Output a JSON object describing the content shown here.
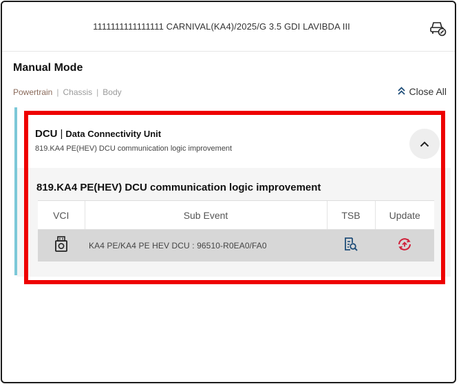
{
  "header": {
    "vehicle_info": "1111111111111111 CARNIVAL(KA4)/2025/G 3.5 GDI LAVIBDA III",
    "vehicle_icon": "car-check-icon"
  },
  "page": {
    "title": "Manual Mode"
  },
  "categories": {
    "tabs": [
      "Powertrain",
      "Chassis",
      "Body"
    ],
    "separator": "|",
    "active": "Powertrain"
  },
  "close_all": {
    "label": "Close All",
    "icon": "double-chevron-up-icon"
  },
  "module": {
    "code": "DCU",
    "separator": "|",
    "name": "Data Connectivity Unit",
    "summary": "819.KA4 PE(HEV) DCU communication logic improvement",
    "collapse_icon": "chevron-up-icon"
  },
  "event": {
    "title": "819.KA4 PE(HEV) DCU communication logic improvement",
    "columns": [
      "VCI",
      "Sub Event",
      "TSB",
      "Update"
    ],
    "rows": [
      {
        "vci_icon": "vci-device-icon",
        "sub_event": "KA4 PE/KA4 PE HEV DCU : 96510-R0EA0/FA0",
        "tsb_icon": "document-search-icon",
        "update_icon": "update-arrow-icon"
      }
    ]
  },
  "colors": {
    "accent_bar": "#7cc8d8",
    "highlight": "#ee0000",
    "update_icon": "#d0203a",
    "tsb_icon": "#1f4e79",
    "active_tab": "#8a6a5a"
  }
}
